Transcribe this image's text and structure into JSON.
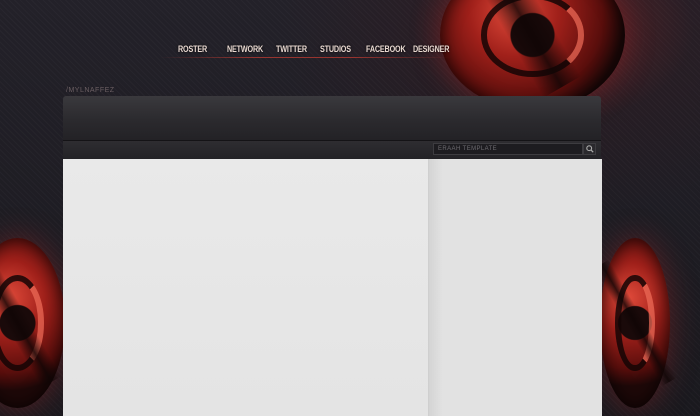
{
  "nav": {
    "items": [
      {
        "label": "ROSTER"
      },
      {
        "label": "NETWORK"
      },
      {
        "label": "TWITTER"
      },
      {
        "label": "STUDIOS"
      },
      {
        "label": "FACEBOOK"
      },
      {
        "label": "DESIGNER"
      }
    ]
  },
  "brand": {
    "text": "/MYLNAFFEZ"
  },
  "search": {
    "placeholder": "ERAAH TEMPLATE",
    "icon": "search-icon"
  },
  "colors": {
    "accent": "#b02820",
    "background": "#1b1a20",
    "content": "#e6e6e6"
  }
}
